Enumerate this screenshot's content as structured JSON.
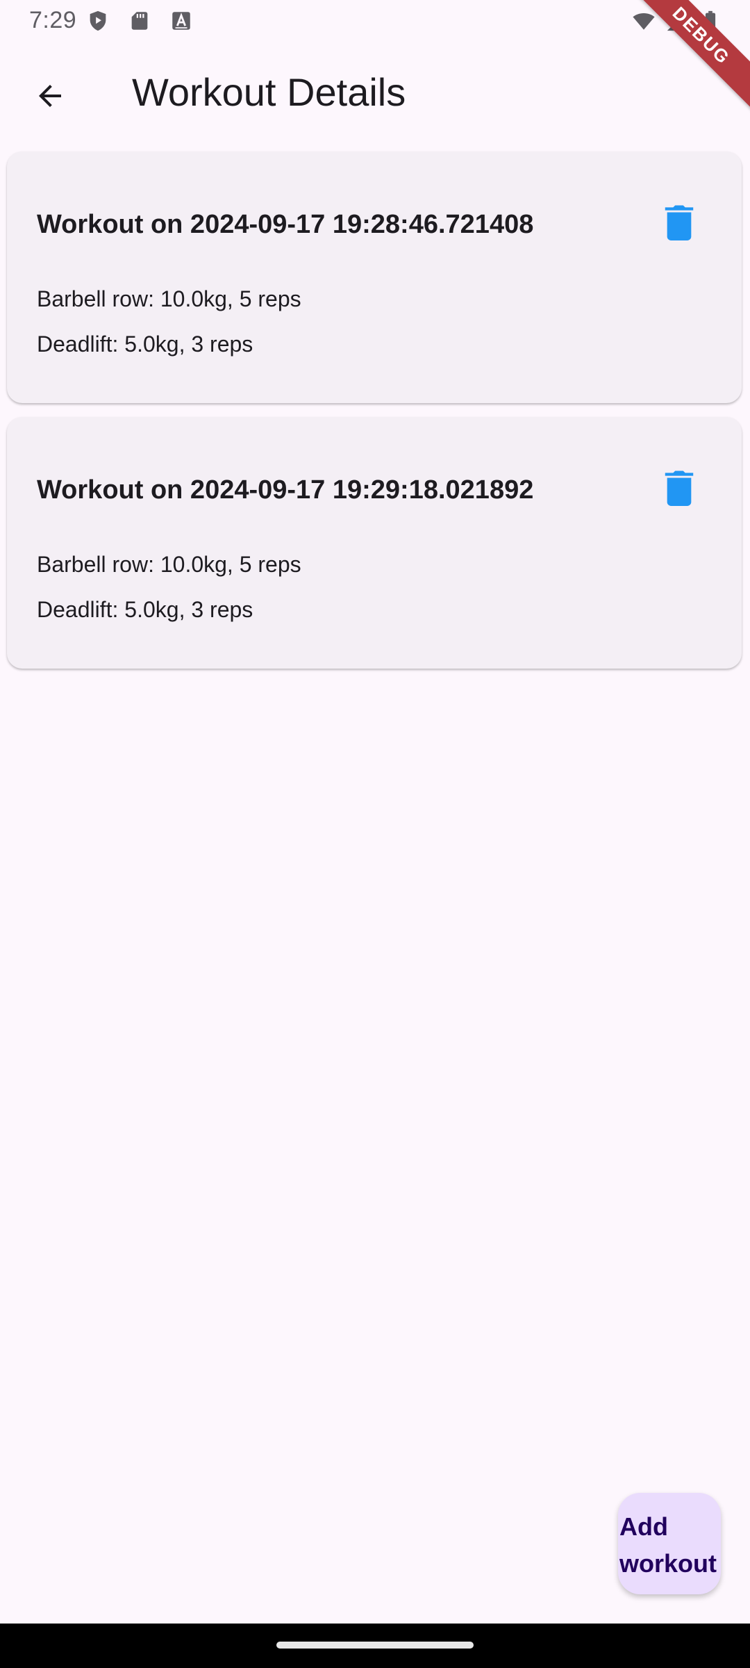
{
  "status_bar": {
    "time": "7:29",
    "left_icons": [
      "shield-play-icon",
      "sd-card-icon",
      "font-a-icon"
    ],
    "right_icons": [
      "wifi-icon",
      "cell-signal-icon",
      "battery-icon"
    ]
  },
  "debug_banner": {
    "label": "DEBUG"
  },
  "app_bar": {
    "back_icon": "arrow-back-icon",
    "title": "Workout Details"
  },
  "workouts": [
    {
      "title": "Workout on 2024-09-17 19:28:46.721408",
      "delete_icon": "trash-icon",
      "exercises": [
        "Barbell row: 10.0kg, 5 reps",
        "Deadlift: 5.0kg, 3 reps"
      ]
    },
    {
      "title": "Workout on 2024-09-17 19:29:18.021892",
      "delete_icon": "trash-icon",
      "exercises": [
        "Barbell row: 10.0kg, 5 reps",
        "Deadlift: 5.0kg, 3 reps"
      ]
    }
  ],
  "fab": {
    "label_line1": "Add",
    "label_line2": "workout"
  },
  "colors": {
    "background": "#fdf7fd",
    "card": "#f4eff5",
    "accent_delete": "#2196f3",
    "fab_bg": "#eadcfd",
    "fab_text": "#21005d",
    "debug_banner": "#b43a3f"
  }
}
